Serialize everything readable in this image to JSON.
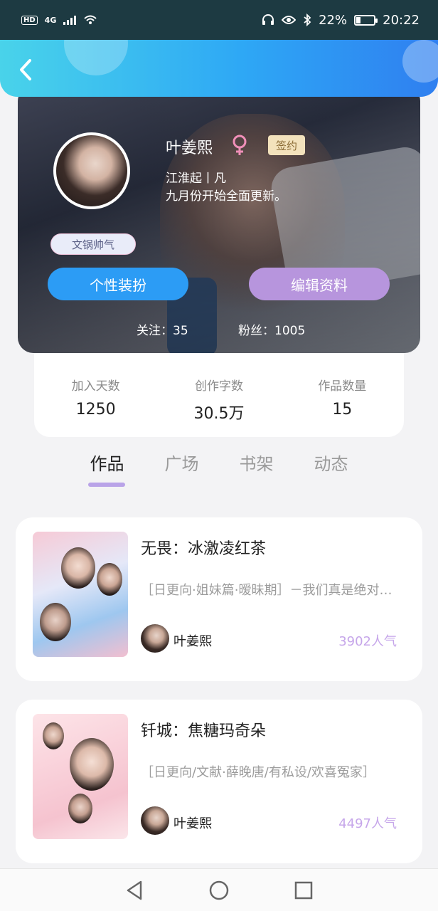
{
  "status_bar": {
    "network": "4G",
    "battery": "22%",
    "time": "20:22"
  },
  "profile": {
    "name": "叶姜熙",
    "sign_badge": "签约",
    "subtitle": "江淮起丨凡",
    "signature": "九月份开始全面更新。",
    "tag": "文锅帅气",
    "dress_button": "个性装扮",
    "edit_button": "编辑资料",
    "follow": "关注：35",
    "fans": "粉丝：1005"
  },
  "stats": [
    {
      "label": "加入天数",
      "value": "1250"
    },
    {
      "label": "创作字数",
      "value": "30.5万"
    },
    {
      "label": "作品数量",
      "value": "15"
    }
  ],
  "tabs": [
    {
      "label": "作品",
      "active": true
    },
    {
      "label": "广场",
      "active": false
    },
    {
      "label": "书架",
      "active": false
    },
    {
      "label": "动态",
      "active": false
    }
  ],
  "works": [
    {
      "title": "无畏：冰激凌红茶",
      "desc": "［日更向·姐妹篇·暧昧期］－我们真是绝对的适配",
      "author": "叶姜熙",
      "popularity": "3902人气"
    },
    {
      "title": "钎城：焦糖玛奇朵",
      "desc": "［日更向/文献·薛晚唐/有私设/欢喜冤家］",
      "author": "叶姜熙",
      "popularity": "4497人气"
    }
  ],
  "colors": {
    "header_gradient_start": "#49d3ea",
    "header_gradient_end": "#2f7ff0",
    "dress_button": "#2c9cf5",
    "edit_button": "#b795dd",
    "popularity": "#c6a6ea",
    "tab_indicator": "#b9a3e8"
  }
}
